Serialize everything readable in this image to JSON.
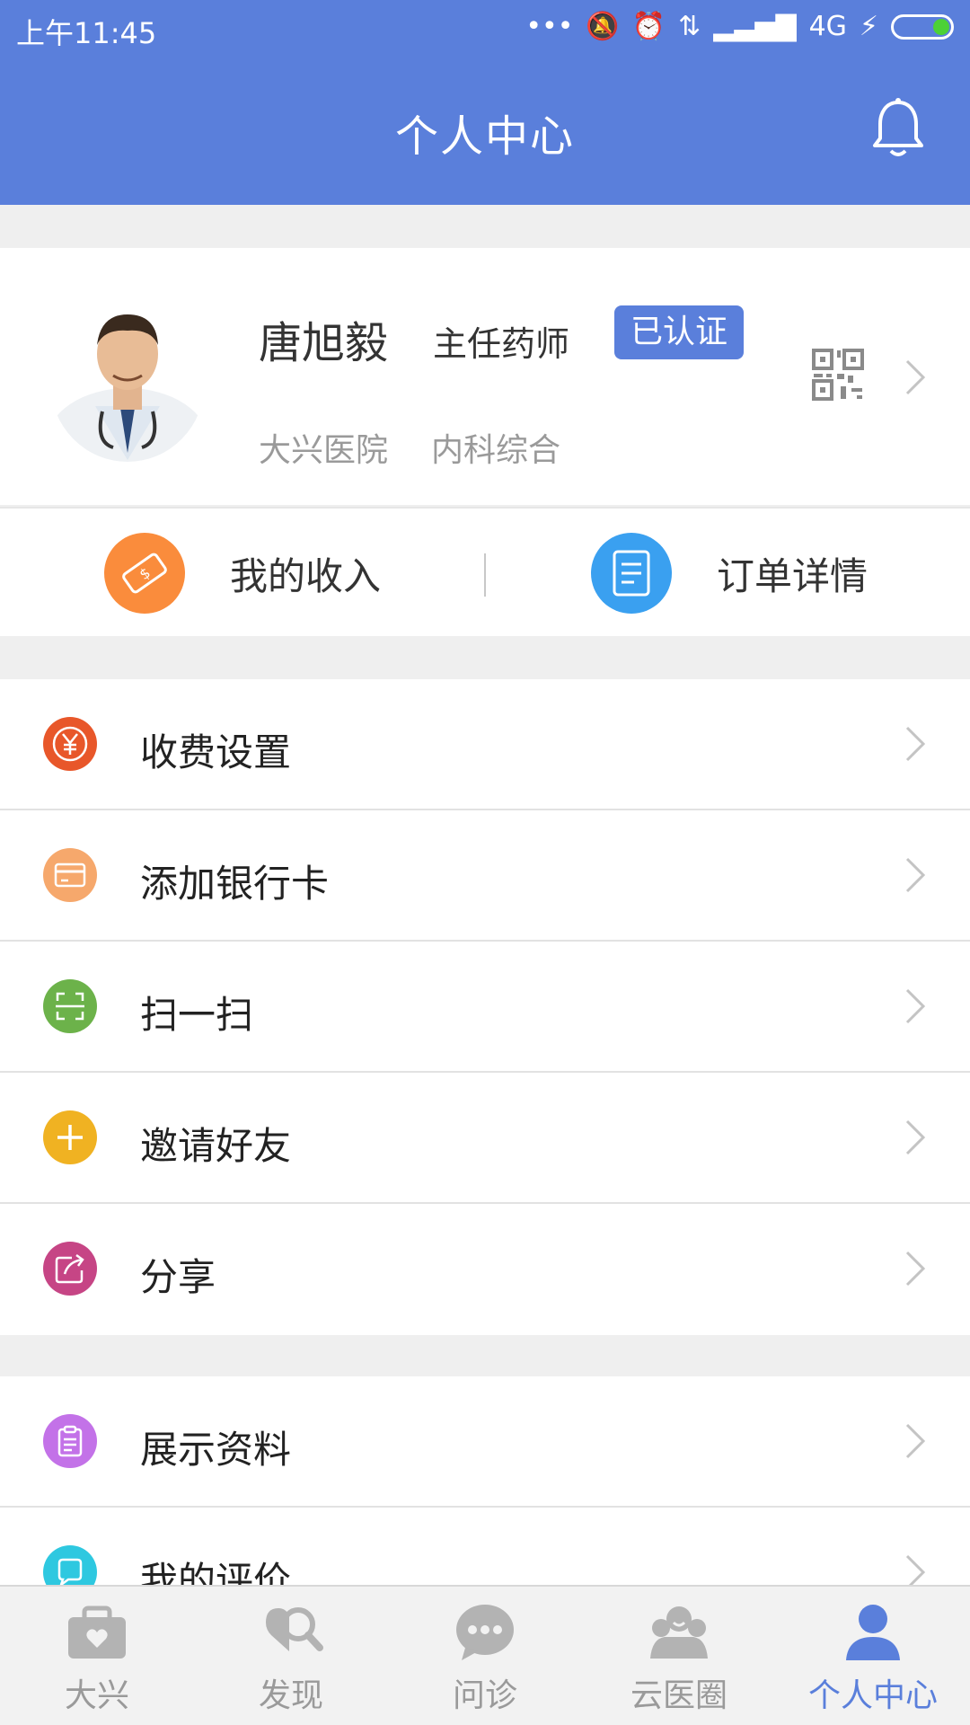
{
  "status_bar": {
    "time": "上午11:45",
    "network": "4G"
  },
  "header": {
    "title": "个人中心"
  },
  "profile": {
    "name": "唐旭毅",
    "title": "主任药师",
    "badge": "已认证",
    "hospital": "大兴医院",
    "department": "内科综合"
  },
  "quick_actions": [
    {
      "label": "我的收入",
      "icon": "money-icon",
      "color": "#fa8c3c"
    },
    {
      "label": "订单详情",
      "icon": "document-icon",
      "color": "#3aa0f0"
    }
  ],
  "menu": [
    {
      "label": "收费设置",
      "icon": "yen-icon",
      "color": "#e8572a"
    },
    {
      "label": "添加银行卡",
      "icon": "card-icon",
      "color": "#f6a86c"
    },
    {
      "label": "扫一扫",
      "icon": "scan-icon",
      "color": "#6cb24a"
    },
    {
      "label": "邀请好友",
      "icon": "plus-icon",
      "color": "#f0b222"
    },
    {
      "label": "分享",
      "icon": "share-icon",
      "color": "#c64585"
    }
  ],
  "menu2": [
    {
      "label": "展示资料",
      "icon": "clipboard-icon",
      "color": "#c372e8"
    },
    {
      "label": "我的评价",
      "icon": "chat-icon",
      "color": "#2ec8e0"
    }
  ],
  "tabs": [
    {
      "label": "大兴",
      "icon": "medkit-icon",
      "active": false
    },
    {
      "label": "发现",
      "icon": "discover-icon",
      "active": false
    },
    {
      "label": "问诊",
      "icon": "consult-icon",
      "active": false
    },
    {
      "label": "云医圈",
      "icon": "group-icon",
      "active": false
    },
    {
      "label": "个人中心",
      "icon": "person-icon",
      "active": true
    }
  ],
  "colors": {
    "primary": "#5a7fdb",
    "inactive_tab": "#b3b3b3"
  }
}
